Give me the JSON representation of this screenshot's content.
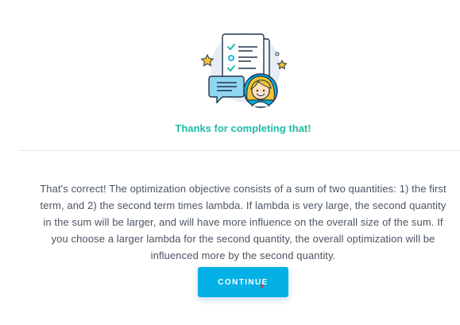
{
  "feedback": {
    "title": "Thanks for completing that!",
    "message": "That's correct! The optimization objective consists of a sum of two quantities: 1) the first term, and 2) the second term times lambda. If lambda is very large, the second quantity in the sum will be larger, and will have more influence on the overall size of the sum. If you choose a larger lambda for the second quantity, the overall optimization will be influenced more by the second quantity."
  },
  "actions": {
    "continue_label": "Continue"
  },
  "illustration": {
    "icon": "checklist-with-smiling-student-icon"
  },
  "colors": {
    "title": "#1fbca8",
    "button": "#04b1e6",
    "text": "#4b5563"
  }
}
